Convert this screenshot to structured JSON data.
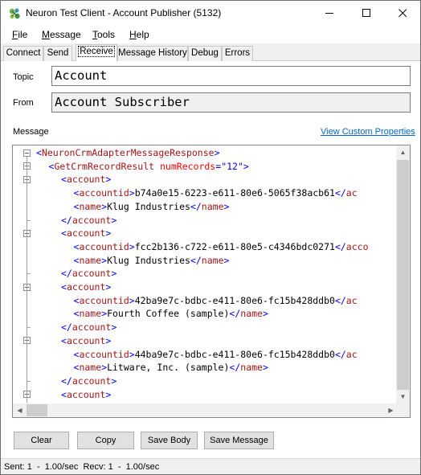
{
  "window": {
    "title": "Neuron Test Client - Account Publisher (5132)"
  },
  "menu": {
    "items": [
      {
        "label": "File",
        "accel": "F",
        "rest": "ile"
      },
      {
        "label": "Message",
        "accel": "M",
        "rest": "essage"
      },
      {
        "label": "Tools",
        "accel": "T",
        "rest": "ools"
      },
      {
        "label": "Help",
        "accel": "H",
        "rest": "elp"
      }
    ]
  },
  "tabs": [
    {
      "label": "Connect",
      "active": false
    },
    {
      "label": "Send",
      "active": false
    },
    {
      "label": "Receive",
      "active": true
    },
    {
      "label": "Message History",
      "active": false
    },
    {
      "label": "Debug",
      "active": false
    },
    {
      "label": "Errors",
      "active": false
    }
  ],
  "receive": {
    "topic_label": "Topic",
    "topic_value": "Account",
    "from_label": "From",
    "from_value": "Account Subscriber",
    "message_label": "Message",
    "view_custom_properties": "View Custom Properties"
  },
  "xml_lines": [
    {
      "indent": 0,
      "open": true,
      "parts": [
        [
          "b",
          "<"
        ],
        [
          "t",
          "NeuronCrmAdapterMessageResponse"
        ],
        [
          "b",
          ">"
        ]
      ]
    },
    {
      "indent": 1,
      "open": true,
      "parts": [
        [
          "b",
          "<"
        ],
        [
          "t",
          "GetCrmRecordResult"
        ],
        [
          "x",
          " "
        ],
        [
          "a",
          "numRecords"
        ],
        [
          "b",
          "="
        ],
        [
          "v",
          "\"12\""
        ],
        [
          "b",
          ">"
        ]
      ]
    },
    {
      "indent": 2,
      "open": true,
      "parts": [
        [
          "b",
          "<"
        ],
        [
          "t",
          "account"
        ],
        [
          "b",
          ">"
        ]
      ]
    },
    {
      "indent": 3,
      "open": false,
      "parts": [
        [
          "b",
          "<"
        ],
        [
          "t",
          "accountid"
        ],
        [
          "b",
          ">"
        ],
        [
          "x",
          "b74a0e15-6223-e611-80e6-5065f38acb61"
        ],
        [
          "b",
          "</"
        ],
        [
          "t",
          "ac"
        ]
      ]
    },
    {
      "indent": 3,
      "open": false,
      "parts": [
        [
          "b",
          "<"
        ],
        [
          "t",
          "name"
        ],
        [
          "b",
          ">"
        ],
        [
          "x",
          "Klug Industries"
        ],
        [
          "b",
          "</"
        ],
        [
          "t",
          "name"
        ],
        [
          "b",
          ">"
        ]
      ]
    },
    {
      "indent": 2,
      "open": false,
      "close": true,
      "parts": [
        [
          "b",
          "</"
        ],
        [
          "t",
          "account"
        ],
        [
          "b",
          ">"
        ]
      ]
    },
    {
      "indent": 2,
      "open": true,
      "parts": [
        [
          "b",
          "<"
        ],
        [
          "t",
          "account"
        ],
        [
          "b",
          ">"
        ]
      ]
    },
    {
      "indent": 3,
      "open": false,
      "parts": [
        [
          "b",
          "<"
        ],
        [
          "t",
          "accountid"
        ],
        [
          "b",
          ">"
        ],
        [
          "x",
          "fcc2b136-c722-e611-80e5-c4346bdc0271"
        ],
        [
          "b",
          "</"
        ],
        [
          "t",
          "acco"
        ]
      ]
    },
    {
      "indent": 3,
      "open": false,
      "parts": [
        [
          "b",
          "<"
        ],
        [
          "t",
          "name"
        ],
        [
          "b",
          ">"
        ],
        [
          "x",
          "Klug Industries"
        ],
        [
          "b",
          "</"
        ],
        [
          "t",
          "name"
        ],
        [
          "b",
          ">"
        ]
      ]
    },
    {
      "indent": 2,
      "open": false,
      "close": true,
      "parts": [
        [
          "b",
          "</"
        ],
        [
          "t",
          "account"
        ],
        [
          "b",
          ">"
        ]
      ]
    },
    {
      "indent": 2,
      "open": true,
      "parts": [
        [
          "b",
          "<"
        ],
        [
          "t",
          "account"
        ],
        [
          "b",
          ">"
        ]
      ]
    },
    {
      "indent": 3,
      "open": false,
      "parts": [
        [
          "b",
          "<"
        ],
        [
          "t",
          "accountid"
        ],
        [
          "b",
          ">"
        ],
        [
          "x",
          "42ba9e7c-bdbc-e411-80e6-fc15b428ddb0"
        ],
        [
          "b",
          "</"
        ],
        [
          "t",
          "ac"
        ]
      ]
    },
    {
      "indent": 3,
      "open": false,
      "parts": [
        [
          "b",
          "<"
        ],
        [
          "t",
          "name"
        ],
        [
          "b",
          ">"
        ],
        [
          "x",
          "Fourth Coffee (sample)"
        ],
        [
          "b",
          "</"
        ],
        [
          "t",
          "name"
        ],
        [
          "b",
          ">"
        ]
      ]
    },
    {
      "indent": 2,
      "open": false,
      "close": true,
      "parts": [
        [
          "b",
          "</"
        ],
        [
          "t",
          "account"
        ],
        [
          "b",
          ">"
        ]
      ]
    },
    {
      "indent": 2,
      "open": true,
      "parts": [
        [
          "b",
          "<"
        ],
        [
          "t",
          "account"
        ],
        [
          "b",
          ">"
        ]
      ]
    },
    {
      "indent": 3,
      "open": false,
      "parts": [
        [
          "b",
          "<"
        ],
        [
          "t",
          "accountid"
        ],
        [
          "b",
          ">"
        ],
        [
          "x",
          "44ba9e7c-bdbc-e411-80e6-fc15b428ddb0"
        ],
        [
          "b",
          "</"
        ],
        [
          "t",
          "ac"
        ]
      ]
    },
    {
      "indent": 3,
      "open": false,
      "parts": [
        [
          "b",
          "<"
        ],
        [
          "t",
          "name"
        ],
        [
          "b",
          ">"
        ],
        [
          "x",
          "Litware, Inc. (sample)"
        ],
        [
          "b",
          "</"
        ],
        [
          "t",
          "name"
        ],
        [
          "b",
          ">"
        ]
      ]
    },
    {
      "indent": 2,
      "open": false,
      "close": true,
      "parts": [
        [
          "b",
          "</"
        ],
        [
          "t",
          "account"
        ],
        [
          "b",
          ">"
        ]
      ]
    },
    {
      "indent": 2,
      "open": true,
      "parts": [
        [
          "b",
          "<"
        ],
        [
          "t",
          "account"
        ],
        [
          "b",
          ">"
        ]
      ]
    }
  ],
  "buttons": {
    "clear": "Clear",
    "copy": "Copy",
    "save_body": "Save Body",
    "save_message": "Save Message"
  },
  "status": {
    "text": "Sent: 1  -  1.00/sec  Recv: 1  -  1.00/sec"
  },
  "colors": {
    "bracket": "#0000ff",
    "tag": "#a31515",
    "attr": "#ff0000",
    "value": "#0000ff",
    "link": "#0066cc"
  }
}
